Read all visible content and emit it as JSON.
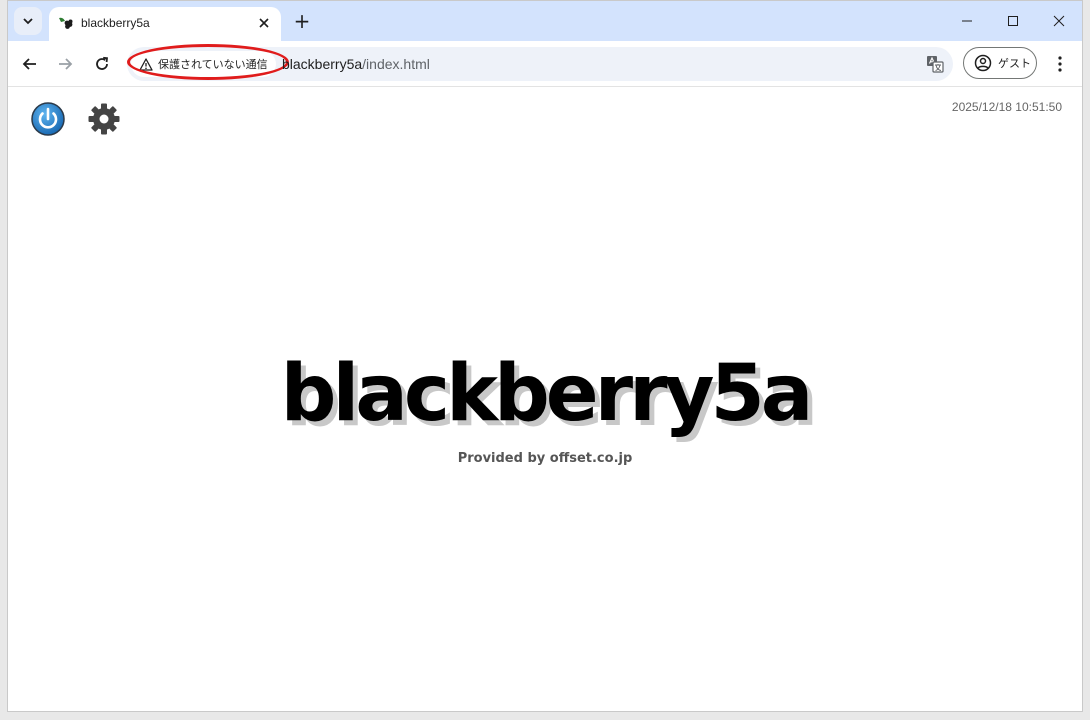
{
  "browser": {
    "tab": {
      "title": "blackberry5a"
    },
    "new_tab_symbol": "+",
    "omnibox": {
      "security_label": "保護されていない通信",
      "url_host": "blackberry5a",
      "url_path": "/index.html"
    },
    "profile_label": "ゲスト"
  },
  "page": {
    "datetime": "2025/12/18 10:51:50",
    "title": "blackberry5a",
    "subtitle": "Provided by offset.co.jp"
  },
  "colors": {
    "tabstrip": "#d3e3fd",
    "power_icon": "#1a78c2",
    "gear_icon": "#444444",
    "annotation_ring": "#e01c1c"
  }
}
